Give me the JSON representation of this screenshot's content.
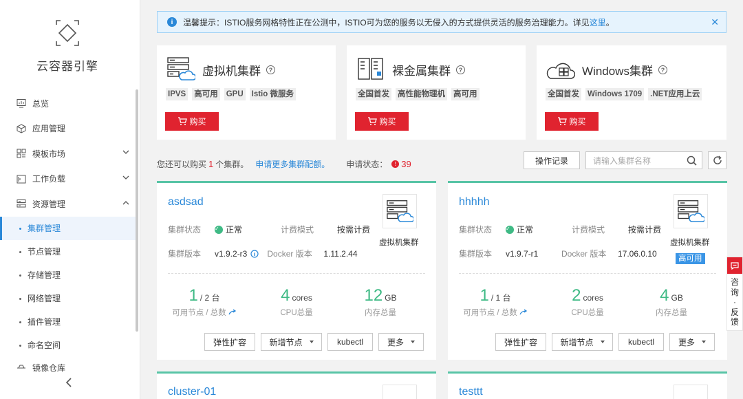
{
  "sidebar": {
    "brand": "云容器引擎",
    "nav": [
      {
        "label": "总览",
        "icon": "dashboard-icon",
        "expandable": false
      },
      {
        "label": "应用管理",
        "icon": "cube-icon",
        "expandable": false
      },
      {
        "label": "模板市场",
        "icon": "grid-icon",
        "expandable": true
      },
      {
        "label": "工作负载",
        "icon": "workload-icon",
        "expandable": true
      },
      {
        "label": "资源管理",
        "icon": "server-icon",
        "expandable": true,
        "expanded": true
      }
    ],
    "sub_items": [
      "集群管理",
      "节点管理",
      "存储管理",
      "网络管理",
      "插件管理",
      "命名空间"
    ],
    "active_sub": "集群管理",
    "partial_item": "镜像仓库"
  },
  "notice": {
    "text": "温馨提示：ISTIO服务网格特性正在公测中，ISTIO可为您的服务以无侵入的方式提供灵活的服务治理能力。详见",
    "link": "这里",
    "end": "。"
  },
  "products": [
    {
      "title": "虚拟机集群",
      "icon": "vm-cluster-icon",
      "tags": [
        "IPVS",
        "高可用",
        "GPU",
        "Istio 微服务"
      ],
      "buy": "购买"
    },
    {
      "title": "裸金属集群",
      "icon": "baremetal-cluster-icon",
      "tags": [
        "全国首发",
        "高性能物理机",
        "高可用"
      ],
      "buy": "购买"
    },
    {
      "title": "Windows集群",
      "icon": "windows-cluster-icon",
      "tags": [
        "全国首发",
        "Windows 1709",
        ".NET应用上云"
      ],
      "buy": "购买"
    }
  ],
  "status": {
    "prefix": "您还可以购买",
    "count": "1",
    "suffix": "个集群。",
    "link": "申请更多集群配额。",
    "apply_label": "申请状态：",
    "apply_count": "39"
  },
  "toolbar": {
    "log_button": "操作记录",
    "search_placeholder": "请输入集群名称"
  },
  "clusters": [
    {
      "name": "asdsad",
      "status_label": "集群状态",
      "status": "正常",
      "billing_label": "计费模式",
      "billing": "按需计费",
      "version_label": "集群版本",
      "version": "v1.9.2-r3",
      "docker_label": "Docker 版本",
      "docker": "1.11.2.44",
      "type": "虚拟机集群",
      "badge": "",
      "nodes": "1",
      "nodes_total": "/ 2 台",
      "nodes_label": "可用节点 / 总数",
      "cpu": "4",
      "cpu_unit": "cores",
      "cpu_label": "CPU总量",
      "mem": "12",
      "mem_unit": "GB",
      "mem_label": "内存总量",
      "buttons": [
        "弹性扩容",
        "新增节点",
        "kubectl",
        "更多"
      ]
    },
    {
      "name": "hhhhh",
      "status_label": "集群状态",
      "status": "正常",
      "billing_label": "计费模式",
      "billing": "按需计费",
      "version_label": "集群版本",
      "version": "v1.9.7-r1",
      "docker_label": "Docker 版本",
      "docker": "17.06.0.10",
      "type": "虚拟机集群",
      "badge": "高可用",
      "nodes": "1",
      "nodes_total": "/ 1 台",
      "nodes_label": "可用节点 / 总数",
      "cpu": "2",
      "cpu_unit": "cores",
      "cpu_label": "CPU总量",
      "mem": "4",
      "mem_unit": "GB",
      "mem_label": "内存总量",
      "buttons": [
        "弹性扩容",
        "新增节点",
        "kubectl",
        "更多"
      ]
    },
    {
      "name": "cluster-01"
    },
    {
      "name": "testtt"
    }
  ],
  "float": {
    "text": "咨询·反馈"
  },
  "colors": {
    "accent": "#2a88d8",
    "buy": "#e0232f",
    "success": "#3fba85",
    "card_border": "#58c4a6"
  }
}
